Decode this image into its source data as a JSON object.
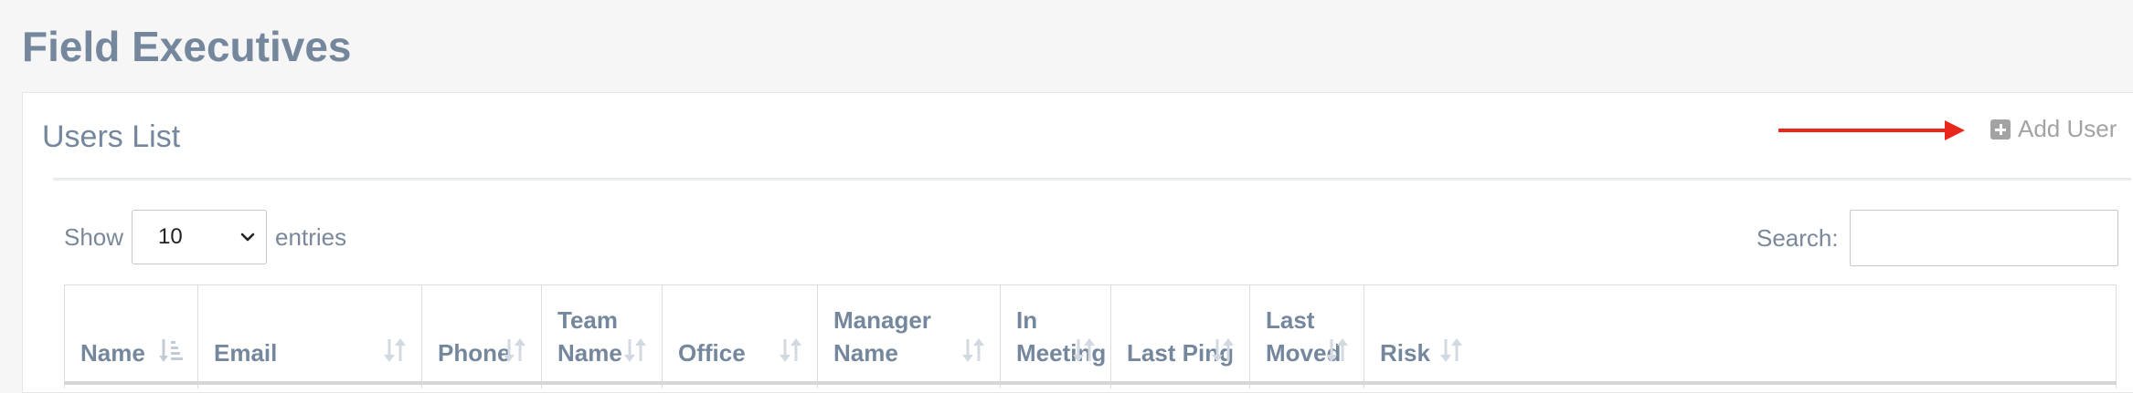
{
  "page": {
    "title": "Field Executives"
  },
  "panel": {
    "title": "Users List",
    "add_user_label": "Add User",
    "add_user_icon": "plus-square-icon",
    "annotation_arrow_color": "#e8261b"
  },
  "length_control": {
    "show_label": "Show",
    "selected_value": "10",
    "entries_label": "entries"
  },
  "search": {
    "label": "Search:",
    "value": "",
    "placeholder": ""
  },
  "table": {
    "columns": [
      {
        "lines": [
          "Name"
        ],
        "sort": "ascending"
      },
      {
        "lines": [
          "Email"
        ],
        "sort": "none"
      },
      {
        "lines": [
          "Phone"
        ],
        "sort": "none"
      },
      {
        "lines": [
          "Team",
          "Name"
        ],
        "sort": "none"
      },
      {
        "lines": [
          "Office"
        ],
        "sort": "none"
      },
      {
        "lines": [
          "Manager Name"
        ],
        "sort": "none"
      },
      {
        "lines": [
          "In",
          "Meeting"
        ],
        "sort": "none"
      },
      {
        "lines": [
          "Last Ping"
        ],
        "sort": "none"
      },
      {
        "lines": [
          "Last",
          "Moved"
        ],
        "sort": "none"
      },
      {
        "lines": [
          "Risk"
        ],
        "sort": "none"
      }
    ]
  },
  "colors": {
    "heading": "#74879c",
    "muted": "#a3a3a3",
    "border": "#dddddd",
    "background": "#f6f6f6"
  }
}
